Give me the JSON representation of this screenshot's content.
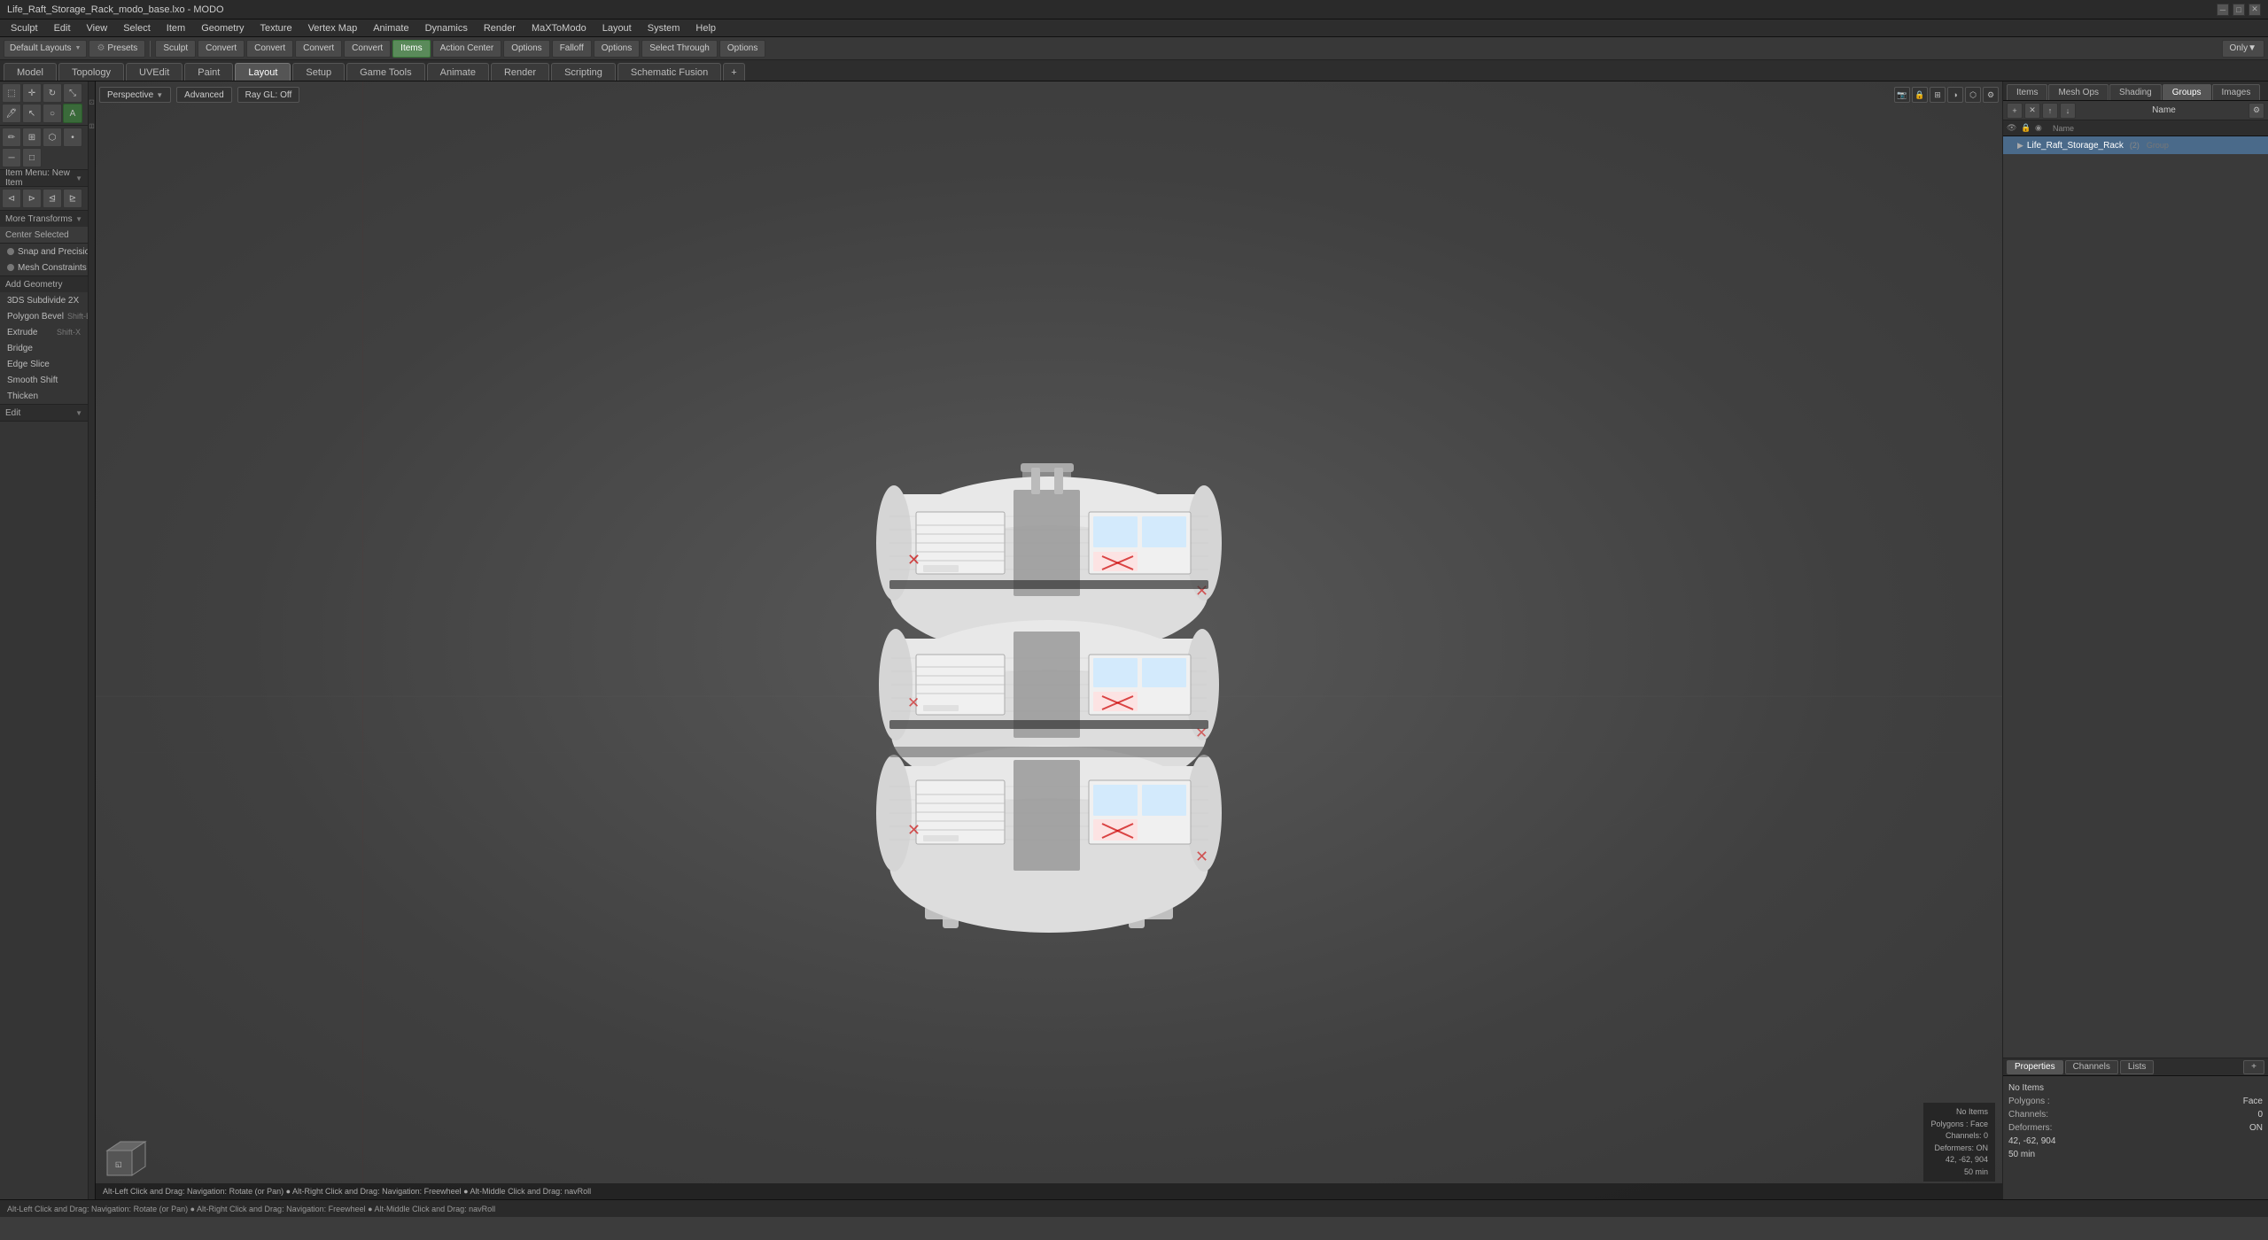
{
  "window": {
    "title": "Life_Raft_Storage_Rack_modo_base.lxo - MODO",
    "controls": [
      "minimize",
      "maximize",
      "close"
    ]
  },
  "menu": {
    "items": [
      "Sculpt",
      "Edit",
      "View",
      "Select",
      "Item",
      "Geometry",
      "Texture",
      "Vertex Map",
      "Animate",
      "Dynamics",
      "Render",
      "MaXToModo",
      "Layout",
      "System",
      "Help"
    ]
  },
  "toolbar1": {
    "layouts_label": "Default Layouts",
    "presets_label": "Presets",
    "sculpt_label": "Sculpt",
    "convert1_label": "Convert",
    "convert2_label": "Convert",
    "convert3_label": "Convert",
    "convert4_label": "Convert",
    "items_label": "Items",
    "action_center_label": "Action Center",
    "options1_label": "Options",
    "falloff_label": "Falloff",
    "options2_label": "Options",
    "select_through_label": "Select Through",
    "options3_label": "Options",
    "plus_label": "+"
  },
  "main_tabs": {
    "tabs": [
      "Model",
      "Topology",
      "UVEdit",
      "Paint",
      "Layout",
      "Setup",
      "Game Tools",
      "Animate",
      "Render",
      "Scripting",
      "Schematic Fusion"
    ]
  },
  "mode_toolbar": {
    "perspective_label": "Perspective",
    "advanced_label": "Advanced",
    "ray_gl_label": "Ray GL: Off"
  },
  "left_panel": {
    "section1": {
      "icons": [
        "move",
        "rotate",
        "scale",
        "select",
        "paint",
        "arrow",
        "circle",
        "triangle",
        "square"
      ]
    },
    "section2": {
      "icons": [
        "pen",
        "grid",
        "curve",
        "mesh",
        "points",
        "edges"
      ]
    },
    "item_menu_label": "Item Menu: New Item",
    "transforms": {
      "label": "More Transforms",
      "center_label": "Center Selected"
    },
    "snap": "Snap and Precision",
    "mesh": "Mesh Constraints",
    "add_geometry": "Add Geometry",
    "tools": [
      {
        "label": "3DS Subdivide 2X",
        "shortcut": ""
      },
      {
        "label": "Polygon Bevel",
        "shortcut": "Shift-B"
      },
      {
        "label": "Extrude",
        "shortcut": "Shift-X"
      },
      {
        "label": "Bridge",
        "shortcut": ""
      },
      {
        "label": "Edge Slice",
        "shortcut": ""
      },
      {
        "label": "Smooth Shift",
        "shortcut": ""
      },
      {
        "label": "Thicken",
        "shortcut": ""
      }
    ],
    "edit_label": "Edit"
  },
  "viewport": {
    "nav_buttons": [
      "Perspective",
      "Advanced",
      "Ray GL: Off"
    ],
    "icons": [
      "camera",
      "light",
      "grid",
      "shading",
      "settings"
    ],
    "info": {
      "no_items": "No Items",
      "polygons": "Polygons : Face",
      "channels": "Channels: 0",
      "deformers": "Deformers: ON",
      "coords": "42, -62, 904",
      "fps": "50 min"
    }
  },
  "status_bar": {
    "hint": "Alt-Left Click and Drag: Navigation: Rotate (or Pan) ● Alt-Right Click and Drag: Navigation: Freewheel ● Alt-Middle Click and Drag: navRoll"
  },
  "right_panel": {
    "tabs": [
      "Items",
      "Mesh Ops",
      "Shading",
      "Groups",
      "Images"
    ],
    "toolbar_buttons": [
      "new_group",
      "delete",
      "move_up",
      "move_down",
      "settings"
    ],
    "name_label": "Name",
    "groups": [
      {
        "label": "Life_Raft_Storage_Rack",
        "count": "(2)",
        "type": "Group",
        "selected": true
      }
    ]
  },
  "right_bottom": {
    "tabs": [
      "Properties",
      "Channels",
      "Lists"
    ],
    "properties": [
      {
        "label": "No Items",
        "value": ""
      },
      {
        "label": "Polygons :",
        "value": "Face"
      },
      {
        "label": "Channels:",
        "value": "0"
      },
      {
        "label": "Deformers:",
        "value": "ON"
      },
      {
        "label": "",
        "value": "42, -62, 904"
      },
      {
        "label": "",
        "value": "50 min"
      }
    ]
  },
  "colors": {
    "bg_dark": "#2a2a2a",
    "bg_mid": "#353535",
    "bg_panel": "#383838",
    "accent_blue": "#4a6a8a",
    "accent_green": "#3a6a3a",
    "accent_orange": "#e87020",
    "active_tab": "#555555",
    "text_normal": "#cccccc",
    "text_dim": "#999999"
  }
}
